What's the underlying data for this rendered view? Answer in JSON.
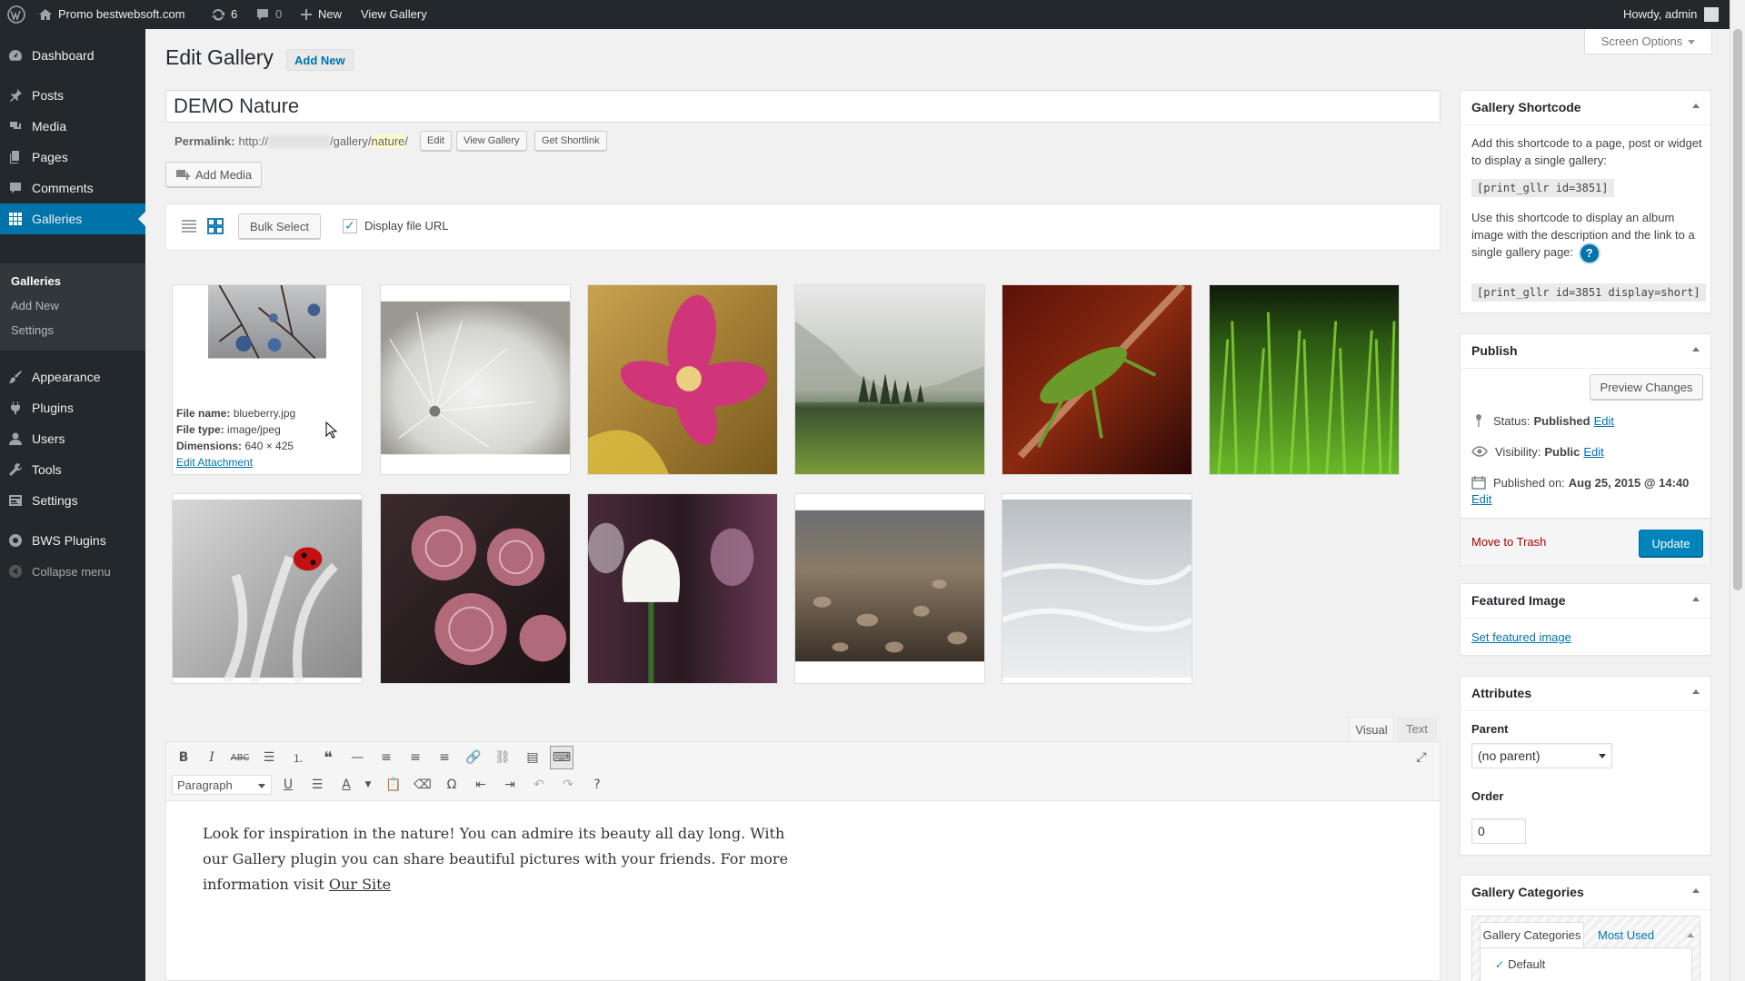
{
  "adminbar": {
    "site_name": "Promo bestwebsoft.com",
    "updates_count": "6",
    "comments_count": "0",
    "new_label": "New",
    "view_gallery": "View Gallery",
    "howdy": "Howdy, admin"
  },
  "sidebar": {
    "items": [
      {
        "label": "Dashboard",
        "icon": "dashboard-icon"
      },
      {
        "label": "Posts",
        "icon": "pin-icon"
      },
      {
        "label": "Media",
        "icon": "media-icon"
      },
      {
        "label": "Pages",
        "icon": "pages-icon"
      },
      {
        "label": "Comments",
        "icon": "comments-icon"
      },
      {
        "label": "Galleries",
        "icon": "grid-icon"
      },
      {
        "label": "Appearance",
        "icon": "brush-icon"
      },
      {
        "label": "Plugins",
        "icon": "plug-icon"
      },
      {
        "label": "Users",
        "icon": "user-icon"
      },
      {
        "label": "Tools",
        "icon": "wrench-icon"
      },
      {
        "label": "Settings",
        "icon": "settings-icon"
      },
      {
        "label": "BWS Plugins",
        "icon": "bws-icon"
      },
      {
        "label": "Collapse menu",
        "icon": "collapse-icon"
      }
    ],
    "submenu": [
      "Galleries",
      "Add New",
      "Settings"
    ]
  },
  "header": {
    "title": "Edit Gallery",
    "add_new": "Add New",
    "screen_options": "Screen Options"
  },
  "post": {
    "title": "DEMO Nature",
    "permalink_label": "Permalink:",
    "permalink_prefix": "http://",
    "permalink_mid": "/gallery/",
    "permalink_slug": "nature",
    "permalink_end": "/",
    "edit": "Edit",
    "view_gallery": "View Gallery",
    "get_shortlink": "Get Shortlink",
    "add_media": "Add Media"
  },
  "toolbar": {
    "bulk_select": "Bulk Select",
    "display_file_url": "Display file URL",
    "display_file_url_checked": true
  },
  "hover_info": {
    "file_name_label": "File name:",
    "file_name": "blueberry.jpg",
    "file_type_label": "File type:",
    "file_type": "image/jpeg",
    "dimensions_label": "Dimensions:",
    "dimensions": "640 × 425",
    "edit_attachment": "Edit Attachment"
  },
  "images": [
    {
      "name": "blueberry"
    },
    {
      "name": "dandelion"
    },
    {
      "name": "pink-flower"
    },
    {
      "name": "mountain-valley"
    },
    {
      "name": "grasshopper"
    },
    {
      "name": "grass"
    },
    {
      "name": "ladybug"
    },
    {
      "name": "roses"
    },
    {
      "name": "tulips"
    },
    {
      "name": "pebbles"
    },
    {
      "name": "snow"
    }
  ],
  "editor": {
    "tab_visual": "Visual",
    "tab_text": "Text",
    "format_select": "Paragraph",
    "content_line1": "Look for inspiration in the nature! You can admire its beauty all day long. With",
    "content_line2": "our Gallery plugin you can share beautiful pictures with your friends. For more",
    "content_line3_prefix": "information visit ",
    "content_link": "Our Site"
  },
  "shortcode_box": {
    "title": "Gallery Shortcode",
    "text1": "Add this shortcode to a page, post or widget to display a single gallery:",
    "code1": "[print_gllr id=3851]",
    "text2": "Use this shortcode to display an album image with the description and the link to a single gallery page:",
    "code2": "[print_gllr id=3851 display=short]"
  },
  "publish_box": {
    "title": "Publish",
    "preview": "Preview Changes",
    "status_label": "Status:",
    "status_value": "Published",
    "visibility_label": "Visibility:",
    "visibility_value": "Public",
    "published_label": "Published on:",
    "published_value": "Aug 25, 2015 @ 14:40",
    "edit": "Edit",
    "trash": "Move to Trash",
    "update": "Update"
  },
  "featured_box": {
    "title": "Featured Image",
    "link": "Set featured image"
  },
  "attributes_box": {
    "title": "Attributes",
    "parent_label": "Parent",
    "parent_value": "(no parent)",
    "order_label": "Order",
    "order_value": "0"
  },
  "categories_box": {
    "title": "Gallery Categories",
    "tab_all": "Gallery Categories",
    "tab_most_used": "Most Used",
    "item_default": "Default"
  },
  "colors": {
    "accent": "#0073aa",
    "admin_dark": "#23282d",
    "update_button": "#0085ba",
    "trash_red": "#a00"
  }
}
